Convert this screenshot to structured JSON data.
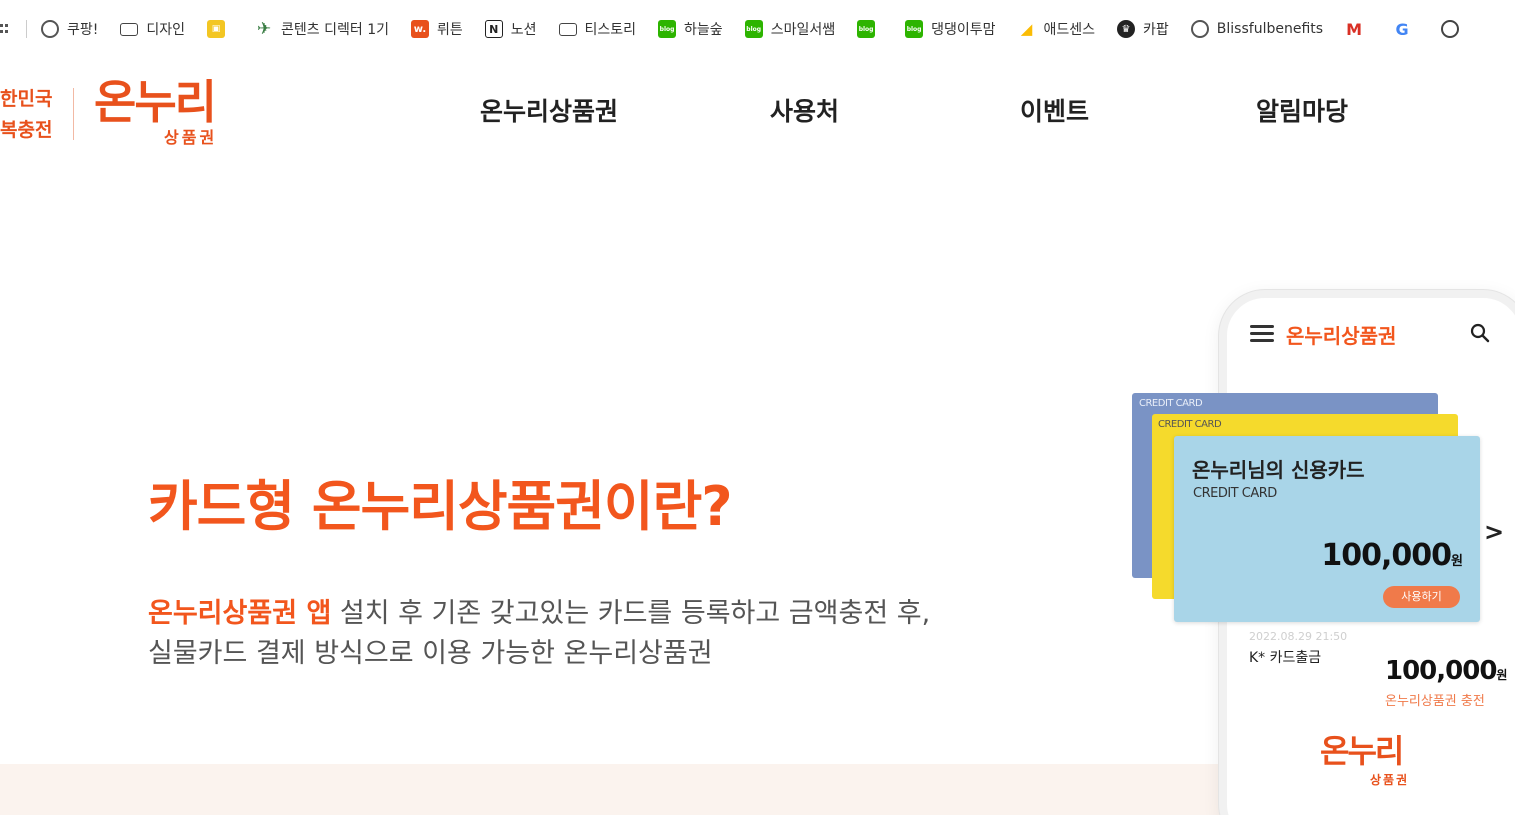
{
  "bookmarks": [
    {
      "label": "쿠팡!",
      "icon": "globe-icon"
    },
    {
      "label": "디자인",
      "icon": "folder-icon"
    },
    {
      "label": "",
      "icon": "google-classroom-icon"
    },
    {
      "label": "콘텐츠 디렉터 1기",
      "icon": "airplane-icon"
    },
    {
      "label": "뤼튼",
      "icon": "wrtn-icon"
    },
    {
      "label": "노션",
      "icon": "notion-icon"
    },
    {
      "label": "티스토리",
      "icon": "folder-icon"
    },
    {
      "label": "하늘숲",
      "icon": "naver-blog-icon"
    },
    {
      "label": "스마일서쌤",
      "icon": "naver-blog-icon"
    },
    {
      "label": "",
      "icon": "naver-blog-icon"
    },
    {
      "label": "댕댕이투맘",
      "icon": "naver-blog-icon"
    },
    {
      "label": "애드센스",
      "icon": "google-ads-icon"
    },
    {
      "label": "카팝",
      "icon": "crown-icon"
    },
    {
      "label": "Blissfulbenefits",
      "icon": "globe-icon"
    },
    {
      "label": "",
      "icon": "gmail-icon"
    },
    {
      "label": "",
      "icon": "google-icon"
    },
    {
      "label": "",
      "icon": "chatgpt-icon"
    }
  ],
  "header": {
    "slogan_line1": "한민국",
    "slogan_line2": "복충전",
    "logo_text": "온누리",
    "logo_sub": "상품권",
    "nav": [
      "온누리상품권",
      "사용처",
      "이벤트",
      "알림마당"
    ]
  },
  "hero": {
    "title": "카드형 온누리상품권이란?",
    "desc_highlight": "온누리상품권 앱",
    "desc_line1_rest": " 설치 후 기존 갖고있는 카드를 등록하고 금액충전 후,",
    "desc_line2": "실물카드 결제 방식으로 이용 가능한 온누리상품권"
  },
  "phone": {
    "app_title": "온누리상품권",
    "card_label": "CREDIT CARD",
    "card_name": "온누리님의 신용카드",
    "card_amount": "100,000",
    "currency": "원",
    "use_button": "사용하기",
    "tx_date": "2022.08.29 21:50",
    "tx_desc": "K* 카드출금",
    "tx_amount": "100,000",
    "tx_note": "온누리상품권 충전",
    "logo_text": "온누리",
    "logo_sub": "상품권"
  },
  "colors": {
    "accent": "#f2561d",
    "card_blue": "#7a93c5",
    "card_yellow": "#f5da2c",
    "card_sky": "#a9d5e8"
  }
}
